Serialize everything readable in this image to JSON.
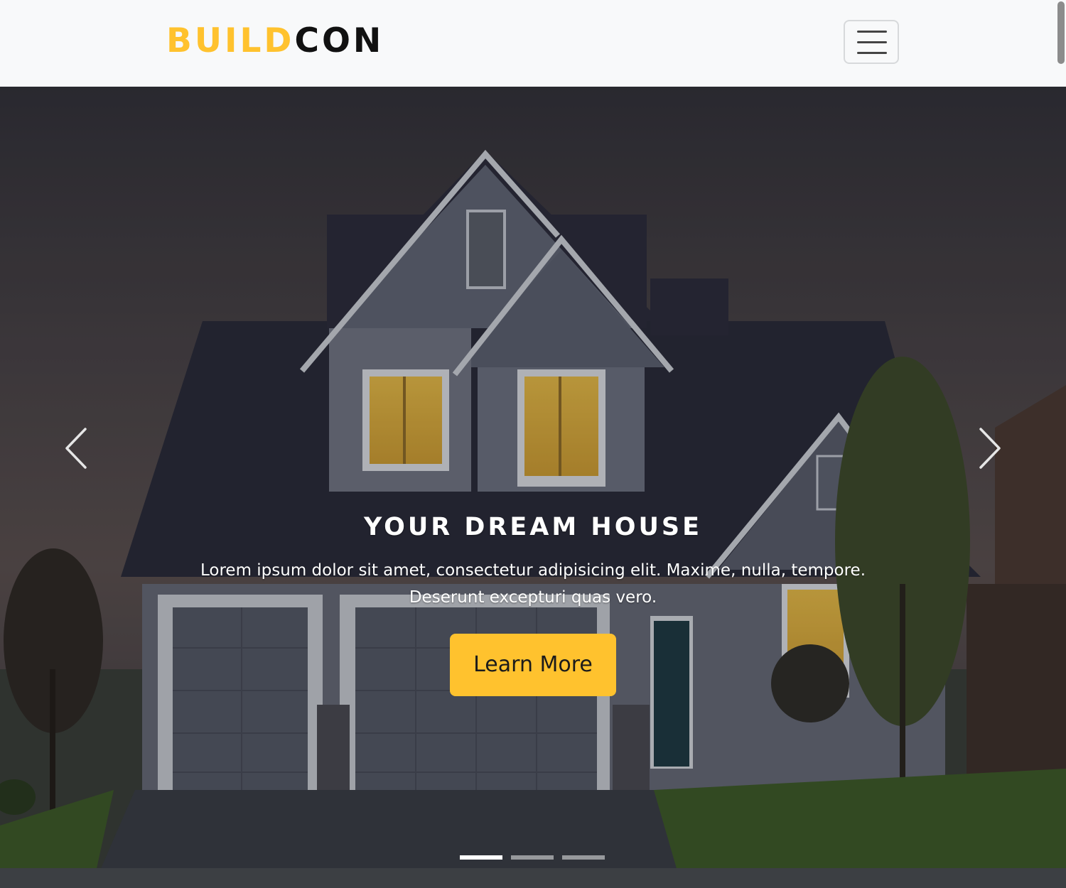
{
  "navbar": {
    "brand_part1": "BUILD",
    "brand_part2": "CON",
    "toggler_icon": "hamburger-menu-icon"
  },
  "colors": {
    "accent": "#ffc22e",
    "navbar_bg": "#f8f9fa",
    "brand_dark": "#111111"
  },
  "carousel": {
    "slides_count": 3,
    "active_index": 0,
    "prev_icon": "chevron-left-icon",
    "next_icon": "chevron-right-icon",
    "slide": {
      "title": "YOUR DREAM HOUSE",
      "text": "Lorem ipsum dolor sit amet, consectetur adipisicing elit. Maxime, nulla, tempore. Deserunt excepturi quas vero.",
      "button_label": "Learn More"
    }
  }
}
